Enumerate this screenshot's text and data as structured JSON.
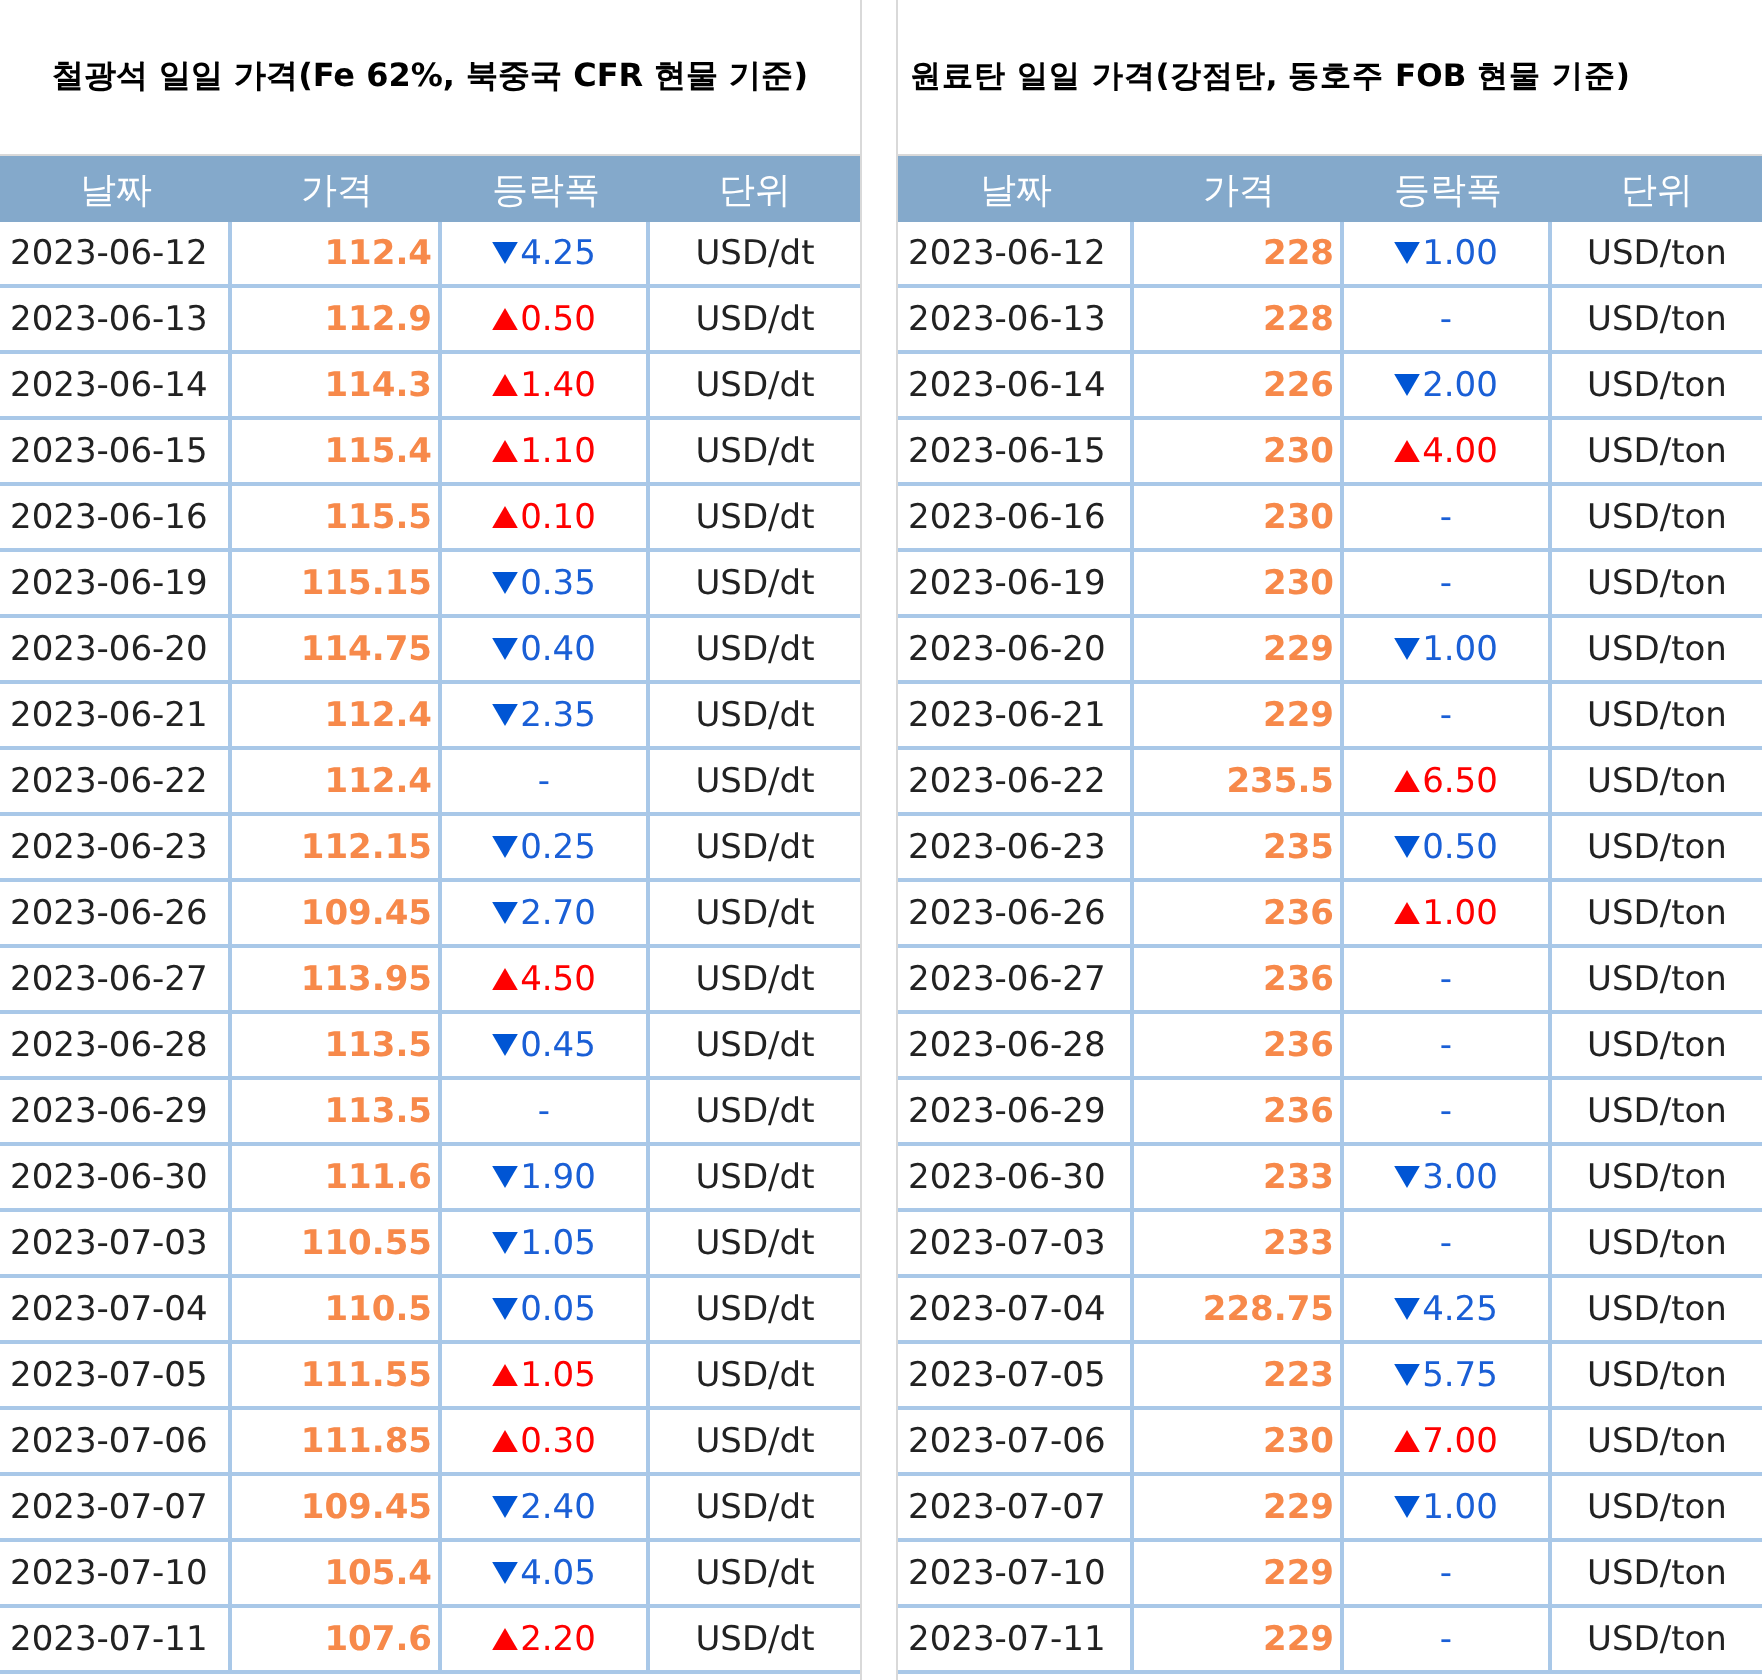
{
  "panels": [
    {
      "title": "철광석 일일 가격(Fe 62%, 북중국 CFR 현물 기준)",
      "columns": [
        "날짜",
        "가격",
        "등락폭",
        "단위"
      ],
      "rows": [
        {
          "date": "2023-06-12",
          "price": "112.4",
          "kind": "down",
          "change": "4.25",
          "unit": "USD/dt"
        },
        {
          "date": "2023-06-13",
          "price": "112.9",
          "kind": "up",
          "change": "0.50",
          "unit": "USD/dt"
        },
        {
          "date": "2023-06-14",
          "price": "114.3",
          "kind": "up",
          "change": "1.40",
          "unit": "USD/dt"
        },
        {
          "date": "2023-06-15",
          "price": "115.4",
          "kind": "up",
          "change": "1.10",
          "unit": "USD/dt"
        },
        {
          "date": "2023-06-16",
          "price": "115.5",
          "kind": "up",
          "change": "0.10",
          "unit": "USD/dt"
        },
        {
          "date": "2023-06-19",
          "price": "115.15",
          "kind": "down",
          "change": "0.35",
          "unit": "USD/dt"
        },
        {
          "date": "2023-06-20",
          "price": "114.75",
          "kind": "down",
          "change": "0.40",
          "unit": "USD/dt"
        },
        {
          "date": "2023-06-21",
          "price": "112.4",
          "kind": "down",
          "change": "2.35",
          "unit": "USD/dt"
        },
        {
          "date": "2023-06-22",
          "price": "112.4",
          "kind": "none",
          "change": "-",
          "unit": "USD/dt"
        },
        {
          "date": "2023-06-23",
          "price": "112.15",
          "kind": "down",
          "change": "0.25",
          "unit": "USD/dt"
        },
        {
          "date": "2023-06-26",
          "price": "109.45",
          "kind": "down",
          "change": "2.70",
          "unit": "USD/dt"
        },
        {
          "date": "2023-06-27",
          "price": "113.95",
          "kind": "up",
          "change": "4.50",
          "unit": "USD/dt"
        },
        {
          "date": "2023-06-28",
          "price": "113.5",
          "kind": "down",
          "change": "0.45",
          "unit": "USD/dt"
        },
        {
          "date": "2023-06-29",
          "price": "113.5",
          "kind": "none",
          "change": "-",
          "unit": "USD/dt"
        },
        {
          "date": "2023-06-30",
          "price": "111.6",
          "kind": "down",
          "change": "1.90",
          "unit": "USD/dt"
        },
        {
          "date": "2023-07-03",
          "price": "110.55",
          "kind": "down",
          "change": "1.05",
          "unit": "USD/dt"
        },
        {
          "date": "2023-07-04",
          "price": "110.5",
          "kind": "down",
          "change": "0.05",
          "unit": "USD/dt"
        },
        {
          "date": "2023-07-05",
          "price": "111.55",
          "kind": "up",
          "change": "1.05",
          "unit": "USD/dt"
        },
        {
          "date": "2023-07-06",
          "price": "111.85",
          "kind": "up",
          "change": "0.30",
          "unit": "USD/dt"
        },
        {
          "date": "2023-07-07",
          "price": "109.45",
          "kind": "down",
          "change": "2.40",
          "unit": "USD/dt"
        },
        {
          "date": "2023-07-10",
          "price": "105.4",
          "kind": "down",
          "change": "4.05",
          "unit": "USD/dt"
        },
        {
          "date": "2023-07-11",
          "price": "107.6",
          "kind": "up",
          "change": "2.20",
          "unit": "USD/dt"
        }
      ]
    },
    {
      "title": "원료탄 일일 가격(강점탄, 동호주 FOB 현물 기준)",
      "columns": [
        "날짜",
        "가격",
        "등락폭",
        "단위"
      ],
      "rows": [
        {
          "date": "2023-06-12",
          "price": "228",
          "kind": "down",
          "change": "1.00",
          "unit": "USD/ton"
        },
        {
          "date": "2023-06-13",
          "price": "228",
          "kind": "none",
          "change": "-",
          "unit": "USD/ton"
        },
        {
          "date": "2023-06-14",
          "price": "226",
          "kind": "down",
          "change": "2.00",
          "unit": "USD/ton"
        },
        {
          "date": "2023-06-15",
          "price": "230",
          "kind": "up",
          "change": "4.00",
          "unit": "USD/ton"
        },
        {
          "date": "2023-06-16",
          "price": "230",
          "kind": "none",
          "change": "-",
          "unit": "USD/ton"
        },
        {
          "date": "2023-06-19",
          "price": "230",
          "kind": "none",
          "change": "-",
          "unit": "USD/ton"
        },
        {
          "date": "2023-06-20",
          "price": "229",
          "kind": "down",
          "change": "1.00",
          "unit": "USD/ton"
        },
        {
          "date": "2023-06-21",
          "price": "229",
          "kind": "none",
          "change": "-",
          "unit": "USD/ton"
        },
        {
          "date": "2023-06-22",
          "price": "235.5",
          "kind": "up",
          "change": "6.50",
          "unit": "USD/ton"
        },
        {
          "date": "2023-06-23",
          "price": "235",
          "kind": "down",
          "change": "0.50",
          "unit": "USD/ton"
        },
        {
          "date": "2023-06-26",
          "price": "236",
          "kind": "up",
          "change": "1.00",
          "unit": "USD/ton"
        },
        {
          "date": "2023-06-27",
          "price": "236",
          "kind": "none",
          "change": "-",
          "unit": "USD/ton"
        },
        {
          "date": "2023-06-28",
          "price": "236",
          "kind": "none",
          "change": "-",
          "unit": "USD/ton"
        },
        {
          "date": "2023-06-29",
          "price": "236",
          "kind": "none",
          "change": "-",
          "unit": "USD/ton"
        },
        {
          "date": "2023-06-30",
          "price": "233",
          "kind": "down",
          "change": "3.00",
          "unit": "USD/ton"
        },
        {
          "date": "2023-07-03",
          "price": "233",
          "kind": "none",
          "change": "-",
          "unit": "USD/ton"
        },
        {
          "date": "2023-07-04",
          "price": "228.75",
          "kind": "down",
          "change": "4.25",
          "unit": "USD/ton"
        },
        {
          "date": "2023-07-05",
          "price": "223",
          "kind": "down",
          "change": "5.75",
          "unit": "USD/ton"
        },
        {
          "date": "2023-07-06",
          "price": "230",
          "kind": "up",
          "change": "7.00",
          "unit": "USD/ton"
        },
        {
          "date": "2023-07-07",
          "price": "229",
          "kind": "down",
          "change": "1.00",
          "unit": "USD/ton"
        },
        {
          "date": "2023-07-10",
          "price": "229",
          "kind": "none",
          "change": "-",
          "unit": "USD/ton"
        },
        {
          "date": "2023-07-11",
          "price": "229",
          "kind": "none",
          "change": "-",
          "unit": "USD/ton"
        }
      ]
    }
  ]
}
